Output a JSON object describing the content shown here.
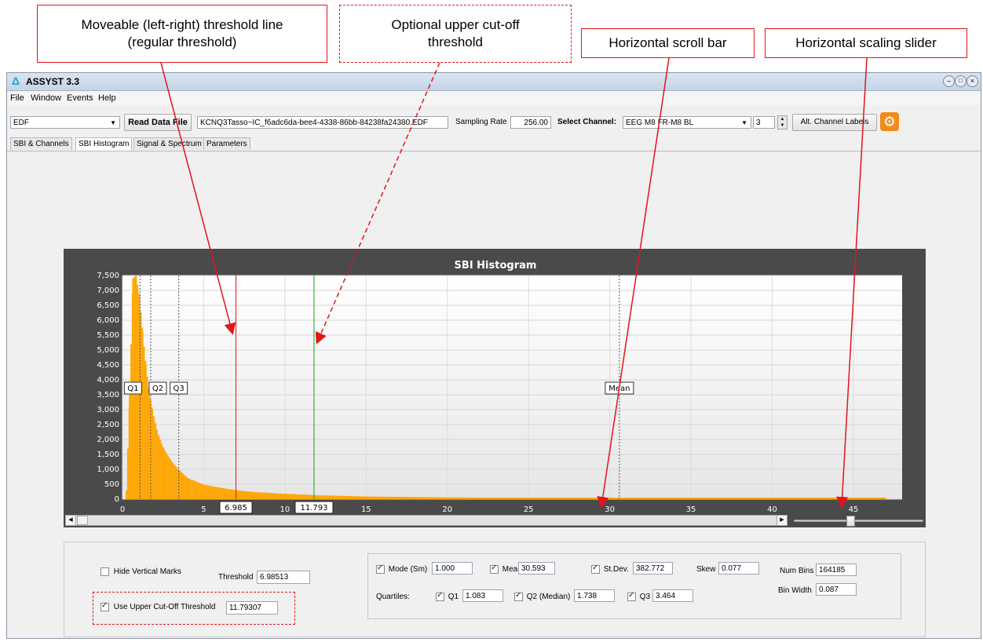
{
  "callouts": {
    "threshold_line": "Moveable (left-right) threshold line\n(regular threshold)",
    "upper_cutoff": "Optional upper cut-off\nthreshold",
    "scroll_bar": "Horizontal scroll bar",
    "scaling_slider": "Horizontal scaling slider"
  },
  "window": {
    "title": "ASSYST 3.3"
  },
  "menu": [
    "File",
    "Window",
    "Events",
    "Help"
  ],
  "toolbar": {
    "format_value": "EDF",
    "read_button": "Read Data File",
    "filename": "KCNQ3Tasso~IC_f6adc6da-bee4-4338-86bb-84238fa24380.EDF",
    "sampling_label": "Sampling Rate",
    "sampling_value": "256.00",
    "channel_label": "Select Channel:",
    "channel_value": "EEG M8 FR-M8 BL",
    "channel_index": "3",
    "alt_labels_button": "Alt. Channel Labels"
  },
  "tabs": [
    "SBI & Channels",
    "SBI Histogram",
    "Signal & Spectrum",
    "Parameters"
  ],
  "chart_data": {
    "type": "bar",
    "title": "SBI Histogram",
    "xlim": [
      0,
      48
    ],
    "ylim": [
      0,
      7500
    ],
    "x_ticks": [
      0,
      5,
      10,
      15,
      20,
      25,
      30,
      35,
      40,
      45
    ],
    "y_ticks": [
      0,
      500,
      1000,
      1500,
      2000,
      2500,
      3000,
      3500,
      4000,
      4500,
      5000,
      5500,
      6000,
      6500,
      7000,
      7500
    ],
    "y_tick_labels": [
      "0",
      "500",
      "1,000",
      "1,500",
      "2,000",
      "2,500",
      "3,000",
      "3,500",
      "4,000",
      "4,500",
      "5,000",
      "5,500",
      "6,000",
      "6,500",
      "7,000",
      "7,500"
    ],
    "x": [
      0.2,
      0.4,
      0.6,
      0.8,
      1.0,
      1.2,
      1.4,
      1.6,
      1.8,
      2.0,
      2.2,
      2.5,
      3.0,
      3.5,
      4.0,
      5.0,
      6.0,
      7.0,
      8.0,
      10.0,
      12.0,
      15.0,
      20.0,
      25.0,
      30.0,
      35.0,
      40.0,
      47.0
    ],
    "values": [
      300,
      3500,
      7400,
      7500,
      6800,
      5600,
      4500,
      3600,
      3000,
      2500,
      2100,
      1700,
      1250,
      950,
      700,
      480,
      380,
      300,
      240,
      180,
      130,
      90,
      60,
      45,
      35,
      25,
      20,
      15
    ],
    "bar_color": "#ffa500",
    "vertical_marks": [
      {
        "label": "Q1",
        "x": 1.083
      },
      {
        "label": "Q2",
        "x": 1.738
      },
      {
        "label": "Q3",
        "x": 3.464
      },
      {
        "label": "Mean",
        "x": 30.593
      }
    ],
    "threshold": {
      "x": 6.985,
      "label": "6.985",
      "color": "#e2141b"
    },
    "upper_cutoff": {
      "x": 11.793,
      "label": "11.793",
      "color": "#1aa01a"
    }
  },
  "stats": {
    "hide_marks_label": "Hide Vertical Marks",
    "threshold_label": "Threshold",
    "threshold_value": "6.98513",
    "use_upper_label": "Use Upper Cut-Off Threshold",
    "upper_value": "11.79307",
    "mode_label": "Mode (Sm)",
    "mode_value": "1.000",
    "mean_label": "Mean",
    "mean_value": "30.593",
    "stdev_label": "St.Dev.",
    "stdev_value": "382.772",
    "skew_label": "Skew",
    "skew_value": "0.077",
    "numbins_label": "Num Bins",
    "numbins_value": "164185",
    "binwidth_label": "Bin Width",
    "binwidth_value": "0.087",
    "quartiles_label": "Quartiles:",
    "q1_label": "Q1",
    "q1_value": "1.083",
    "q2_label": "Q2 (Median)",
    "q2_value": "1.738",
    "q3_label": "Q3",
    "q3_value": "3.464"
  },
  "colors": {
    "annotation": "#e2141b",
    "chart_bg": "#4a4a4a"
  }
}
